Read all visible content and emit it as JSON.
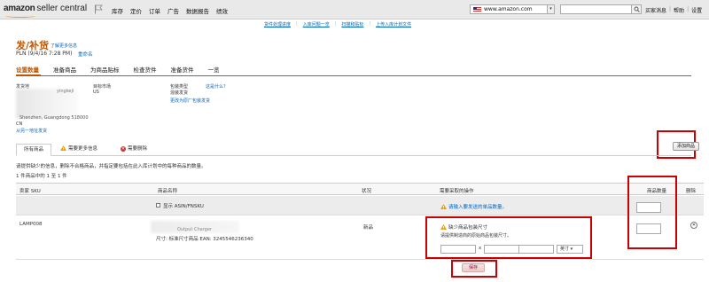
{
  "header": {
    "logo_brand": "amazon",
    "logo_product": "seller central",
    "nav": [
      "库存",
      "定价",
      "订单",
      "广告",
      "数据报告",
      "绩效"
    ],
    "marketplace": "www.amazon.com",
    "right_links": [
      "买家消息",
      "帮助",
      "设置"
    ],
    "brand_color": "#f29b1d"
  },
  "sublinks": [
    "货件处理进度",
    "入库问题一览",
    "扫描和贴标",
    "上传入库计划文件"
  ],
  "page": {
    "title": "发/补货",
    "learn_more": "了解更多信息",
    "plan_name": "PLN (9/4/16 7:28 PM)",
    "rename": "重命名"
  },
  "steps": [
    "设置数量",
    "准备商品",
    "为商品贴标",
    "检查货件",
    "准备货件",
    "一览"
  ],
  "address": {
    "ship_from_label": "发货地",
    "ship_from_fragment": "yingkeji",
    "ship_from_city": "Shenzhen, Guangdong 518000",
    "ship_from_country": "CN",
    "ship_from_other": "从另一地址发货",
    "ship_to_label": "目标市场",
    "ship_to_value": "US",
    "packing_type_label": "包装类型",
    "packing_type_link": "这是什么？",
    "packing_type_value": "混装发货",
    "packing_change": "更改为原厂包装发货"
  },
  "add_button": "添加商品",
  "filter_tabs": {
    "all": "所有商品",
    "more_info": "需要更多信息",
    "remove": "需要删除"
  },
  "instructions": "请提供缺少的信息，删除不合格商品，并指定要包括在此入库计划中的每种商品的数量。",
  "count_line": "1 件商品中的 1 至 1 件",
  "table": {
    "headers": {
      "sku": "卖家 SKU",
      "name": "商品名称",
      "condition": "状况",
      "action": "需要采取的操作",
      "quantity": "商品数量",
      "delete": "删除"
    },
    "show_asin": "显示 ASIN/FNSKU",
    "top_warning": "请输入要发送的单品数量。",
    "row": {
      "sku": "LAMP008",
      "name_fragment": "Output Charger",
      "size": "尺寸: 标准尺寸商品 EAN: 3245546236340",
      "condition": "新品",
      "action_title": "缺少商品包装尺寸",
      "action_desc": "请提供制造商的原始商品包装尺寸。",
      "dim_separator": "x",
      "unit": "英寸"
    }
  },
  "save_button": "保存"
}
